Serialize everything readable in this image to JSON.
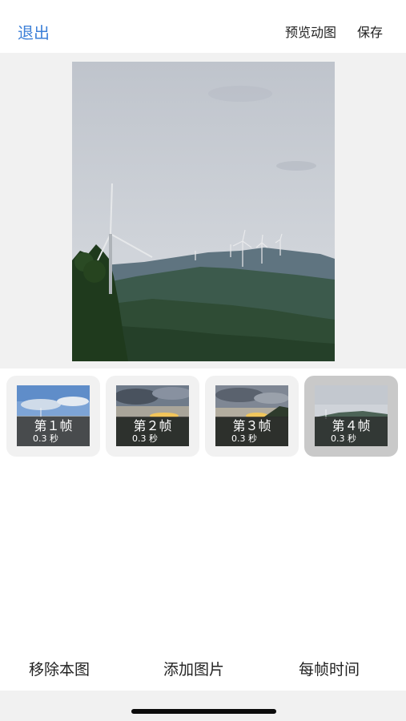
{
  "header": {
    "exit_label": "退出",
    "preview_label": "预览动图",
    "save_label": "保存"
  },
  "frames": [
    {
      "title": "第１帧",
      "duration": "0.3 秒",
      "selected": false,
      "thumbnail": "blue-sky-clouds"
    },
    {
      "title": "第２帧",
      "duration": "0.3 秒",
      "selected": false,
      "thumbnail": "sunset-dark-clouds"
    },
    {
      "title": "第３帧",
      "duration": "0.3 秒",
      "selected": false,
      "thumbnail": "sunset-hills"
    },
    {
      "title": "第４帧",
      "duration": "0.3 秒",
      "selected": true,
      "thumbnail": "overcast-wind-turbines"
    }
  ],
  "bottom": {
    "remove_label": "移除本图",
    "add_label": "添加图片",
    "time_label": "每帧时间"
  },
  "colors": {
    "accent": "#3d80d8",
    "panel_bg": "#f1f1f1",
    "selected_card": "#c9c9c9"
  }
}
